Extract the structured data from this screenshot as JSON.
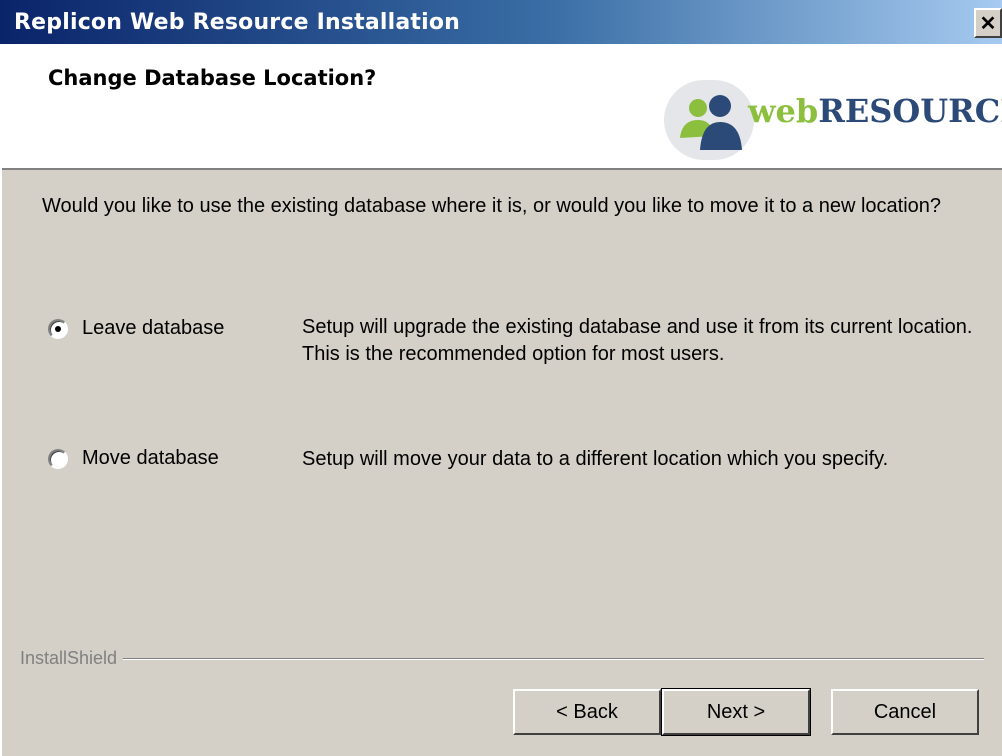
{
  "window": {
    "title": "Replicon Web Resource Installation",
    "close_glyph": "✕"
  },
  "header": {
    "title": "Change Database Location?",
    "logo": {
      "web": "web",
      "resource": "RESOURCE",
      "icon": "people-icon"
    }
  },
  "question": "Would you like to use the existing database where it is, or would you like to move it to a new location?",
  "options": [
    {
      "label": "Leave database",
      "checked": true,
      "description": "Setup will upgrade the existing database and use it from its current location.  This is the recommended option for most users."
    },
    {
      "label": "Move database",
      "checked": false,
      "description": "Setup will move your data to a different location which you specify."
    }
  ],
  "footer": {
    "brand": "InstallShield",
    "back_label": "< Back",
    "next_label": "Next >",
    "cancel_label": "Cancel"
  },
  "colors": {
    "title_start": "#0a246a",
    "title_end": "#a6caf0",
    "logo_green": "#8dbf3f",
    "logo_blue": "#2b4a78",
    "dialog_bg": "#d4d0c8"
  }
}
